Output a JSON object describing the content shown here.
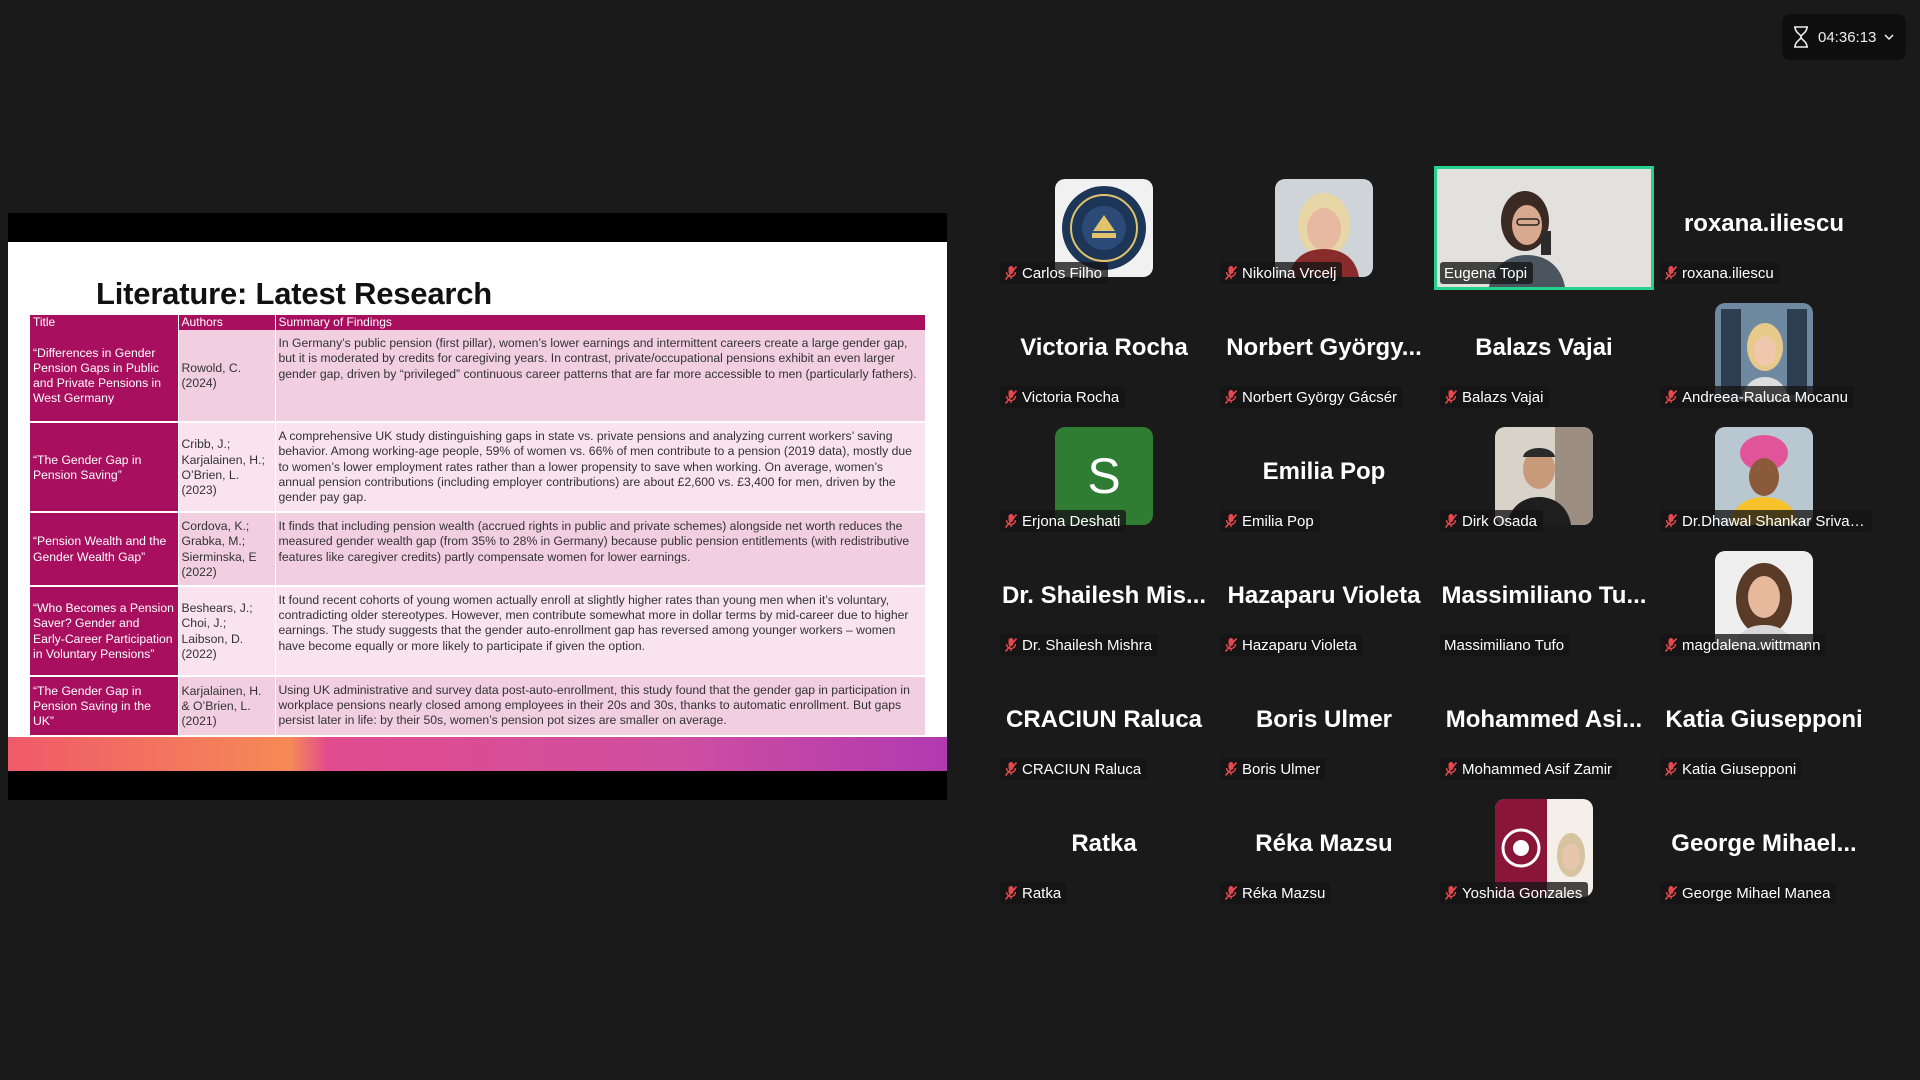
{
  "timer": {
    "value": "04:36:13"
  },
  "colors": {
    "accent_active": "#23d18b",
    "table_header": "#a8105f"
  },
  "slide": {
    "title": "Literature: Latest Research",
    "headers": [
      "Title",
      "Authors",
      "Summary of Findings"
    ],
    "rows": [
      {
        "title": "“Differences in Gender Pension Gaps in Public and Private Pensions in West Germany",
        "authors": "Rowold, C. (2024)",
        "summary": "In Germany’s public pension (first pillar), women’s lower earnings and intermittent careers create a large gender gap, but it is moderated by credits for caregiving years. In contrast, private/occupational pensions exhibit an even larger gender gap, driven by “privileged” continuous career patterns that are far more accessible to men (particularly fathers)."
      },
      {
        "title": "“The Gender Gap in Pension Saving”",
        "authors": "Cribb, J.; Karjalainen, H.; O’Brien, L. (2023)",
        "summary": "A comprehensive UK study distinguishing gaps in state vs. private pensions and analyzing current workers’ saving behavior. Among working-age people, 59% of women vs. 66% of men contribute to a pension (2019 data), mostly due to women’s lower employment rates rather than a lower propensity to save when working. On average, women’s annual pension contributions (including employer contributions) are about £2,600 vs. £3,400 for men, driven by the gender pay gap."
      },
      {
        "title": "“Pension Wealth and the Gender Wealth Gap”",
        "authors": "Cordova, K.; Grabka, M.; Sierminska, E (2022)",
        "summary": "It finds that including pension wealth (accrued rights in public and private schemes) alongside net worth reduces the measured gender wealth gap (from 35% to 28% in Germany) because public pension entitlements (with redistributive features like caregiver credits) partly compensate women for lower earnings."
      },
      {
        "title": "“Who Becomes a Pension Saver? Gender and Early-Career Participation in Voluntary Pensions”",
        "authors": "Beshears, J.; Choi, J.; Laibson, D. (2022)",
        "summary": "It found recent cohorts of young women actually enroll at slightly higher rates than young men when it’s voluntary, contradicting older stereotypes. However, men contribute somewhat more in dollar terms by mid-career due to higher earnings. The study suggests that the gender auto-enrollment gap has reversed among younger workers – women have become equally or more likely to participate if given the option."
      },
      {
        "title": "“The Gender Gap in Pension Saving in the UK”",
        "authors": "Karjalainen, H. & O’Brien, L. (2021)",
        "summary": "Using UK administrative and survey data post-auto-enrollment, this study found that the gender gap in participation in workplace pensions nearly closed among employees in their 20s and 30s, thanks to automatic enrollment. But gaps persist later in life: by their 50s, women’s pension pot sizes are smaller on average."
      }
    ]
  },
  "participants": [
    {
      "label": "Carlos Filho",
      "display": "",
      "avatar": "logo-seal",
      "muted": true
    },
    {
      "label": "Nikolina Vrcelj",
      "display": "",
      "avatar": "photo-blonde",
      "muted": true
    },
    {
      "label": "Eugena Topi",
      "display": "",
      "avatar": "video",
      "muted": false,
      "active": true
    },
    {
      "label": "roxana.iliescu",
      "display": "roxana.iliescu",
      "avatar": "",
      "muted": true
    },
    {
      "label": "Victoria Rocha",
      "display": "Victoria Rocha",
      "avatar": "",
      "muted": true
    },
    {
      "label": "Norbert György Gácsér",
      "display": "Norbert György...",
      "avatar": "",
      "muted": true
    },
    {
      "label": "Balazs Vajai",
      "display": "Balazs Vajai",
      "avatar": "",
      "muted": true
    },
    {
      "label": "Andreea-Raluca Mocanu",
      "display": "",
      "avatar": "photo-window",
      "muted": true
    },
    {
      "label": "Erjona Deshati",
      "display": "",
      "avatar": "letter-s",
      "muted": true,
      "letter": "S"
    },
    {
      "label": "Emilia Pop",
      "display": "Emilia Pop",
      "avatar": "",
      "muted": true
    },
    {
      "label": "Dirk Osada",
      "display": "",
      "avatar": "photo-man",
      "muted": true
    },
    {
      "label": "Dr.Dhawal Shankar Srivas...",
      "display": "",
      "avatar": "photo-turban",
      "muted": true
    },
    {
      "label": "Dr. Shailesh Mishra",
      "display": "Dr. Shailesh Mis...",
      "avatar": "",
      "muted": true
    },
    {
      "label": "Hazaparu Violeta",
      "display": "Hazaparu Violeta",
      "avatar": "",
      "muted": true
    },
    {
      "label": "Massimiliano Tufo",
      "display": "Massimiliano Tu...",
      "avatar": "",
      "muted": false
    },
    {
      "label": "magdalena.wittmann",
      "display": "",
      "avatar": "photo-woman",
      "muted": true
    },
    {
      "label": "CRACIUN Raluca",
      "display": "CRACIUN Raluca",
      "avatar": "",
      "muted": true
    },
    {
      "label": "Boris Ulmer",
      "display": "Boris Ulmer",
      "avatar": "",
      "muted": true
    },
    {
      "label": "Mohammed Asif Zamir",
      "display": "Mohammed Asi...",
      "avatar": "",
      "muted": true
    },
    {
      "label": "Katia Giusepponi",
      "display": "Katia Giusepponi",
      "avatar": "",
      "muted": true
    },
    {
      "label": "Ratka",
      "display": "Ratka",
      "avatar": "",
      "muted": true
    },
    {
      "label": "Réka Mazsu",
      "display": "Réka Mazsu",
      "avatar": "",
      "muted": true
    },
    {
      "label": "Yoshida Gonzales",
      "display": "",
      "avatar": "logo-university",
      "muted": true
    },
    {
      "label": "George Mihael Manea",
      "display": "George Mihael...",
      "avatar": "",
      "muted": true
    }
  ]
}
